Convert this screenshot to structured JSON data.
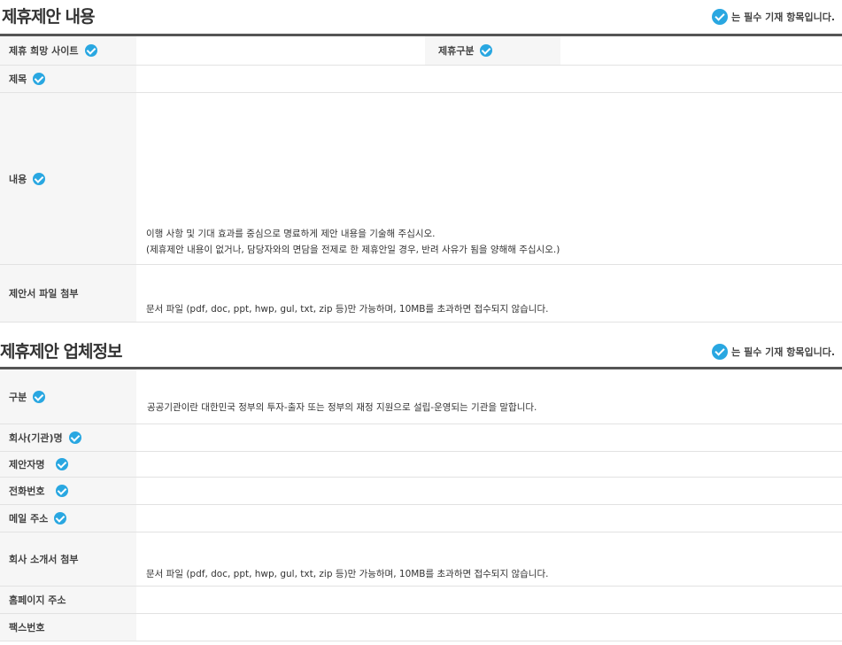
{
  "section1": {
    "title": "제휴제안 내용",
    "required_note": "는 필수 기재 항목입니다.",
    "fields": {
      "site": "제휴 희망 사이트",
      "type": "제휴구분",
      "subject": "제목",
      "content": "내용",
      "content_hint1": "이행 사항 및 기대 효과를 중심으로 명료하게 제안 내용을 기술해 주십시오.",
      "content_hint2": "(제휴제안 내용이 없거나, 담당자와의 면담을 전제로 한 제휴안일 경우, 반려 사유가 됨을 양해해 주십시오.)",
      "attach": "제안서 파일 첨부",
      "attach_hint": "문서 파일 (pdf, doc, ppt, hwp, gul, txt, zip 등)만 가능하며, 10MB를 초과하면 접수되지 않습니다."
    }
  },
  "section2": {
    "title": "제휴제안 업체정보",
    "required_note": "는 필수 기재 항목입니다.",
    "fields": {
      "category": "구분",
      "category_hint": "공공기관이란 대한민국 정부의 투자-출자 또는 정부의 재정 지원으로 설립-운영되는 기관을 말합니다.",
      "company": "회사(기관)명",
      "proposer": "제안자명",
      "phone": "전화번호",
      "email": "메일 주소",
      "intro": "회사 소개서 첨부",
      "intro_hint": "문서 파일 (pdf, doc, ppt, hwp, gul, txt, zip 등)만 가능하며, 10MB를 초과하면 접수되지 않습니다.",
      "homepage": "홈페이지 주소",
      "fax": "팩스번호"
    }
  },
  "colors": {
    "accent": "#29a7e1",
    "label_bg": "#f6f6f6",
    "rule": "#555555"
  }
}
